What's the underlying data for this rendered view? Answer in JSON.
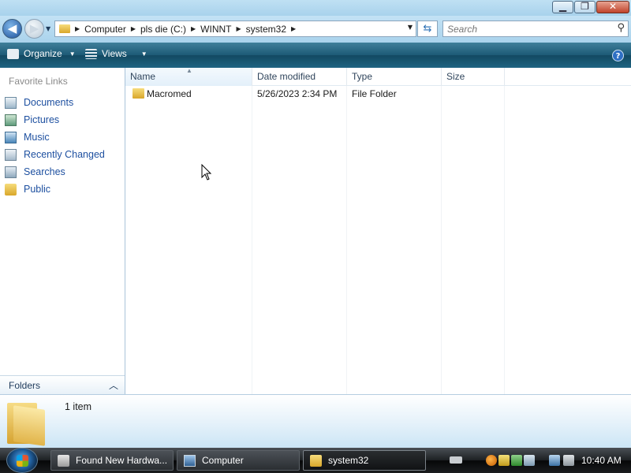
{
  "window": {
    "minimize_glyph": "▁",
    "maximize_glyph": "❐",
    "close_glyph": "✕"
  },
  "nav": {
    "back_glyph": "◀",
    "forward_glyph": "▶"
  },
  "address": {
    "crumbs": [
      "Computer",
      "pls die (C:)",
      "WINNT",
      "system32"
    ]
  },
  "search": {
    "placeholder": "Search"
  },
  "toolbar": {
    "organize_label": "Organize",
    "views_label": "Views",
    "help_glyph": "?"
  },
  "sidebar": {
    "heading": "Favorite Links",
    "items": [
      {
        "label": "Documents",
        "icon": "documents-icon"
      },
      {
        "label": "Pictures",
        "icon": "pictures-icon"
      },
      {
        "label": "Music",
        "icon": "music-icon"
      },
      {
        "label": "Recently Changed",
        "icon": "recently-changed-icon"
      },
      {
        "label": "Searches",
        "icon": "searches-icon"
      },
      {
        "label": "Public",
        "icon": "public-folder-icon"
      }
    ],
    "folders_label": "Folders"
  },
  "filelist": {
    "columns": [
      "Name",
      "Date modified",
      "Type",
      "Size"
    ],
    "rows": [
      {
        "name": "Macromed",
        "date_modified": "5/26/2023 2:34 PM",
        "type": "File Folder",
        "size": ""
      }
    ]
  },
  "details": {
    "item_count": "1 item"
  },
  "taskbar": {
    "tasks": [
      {
        "label": "Found New Hardwa...",
        "active": false
      },
      {
        "label": "Computer",
        "active": false
      },
      {
        "label": "system32",
        "active": true
      }
    ],
    "clock": "10:40 AM"
  },
  "colors": {
    "command_bar": "#1d5a76",
    "link_text": "#1e50a0",
    "folder_yellow": "#e1b449"
  }
}
